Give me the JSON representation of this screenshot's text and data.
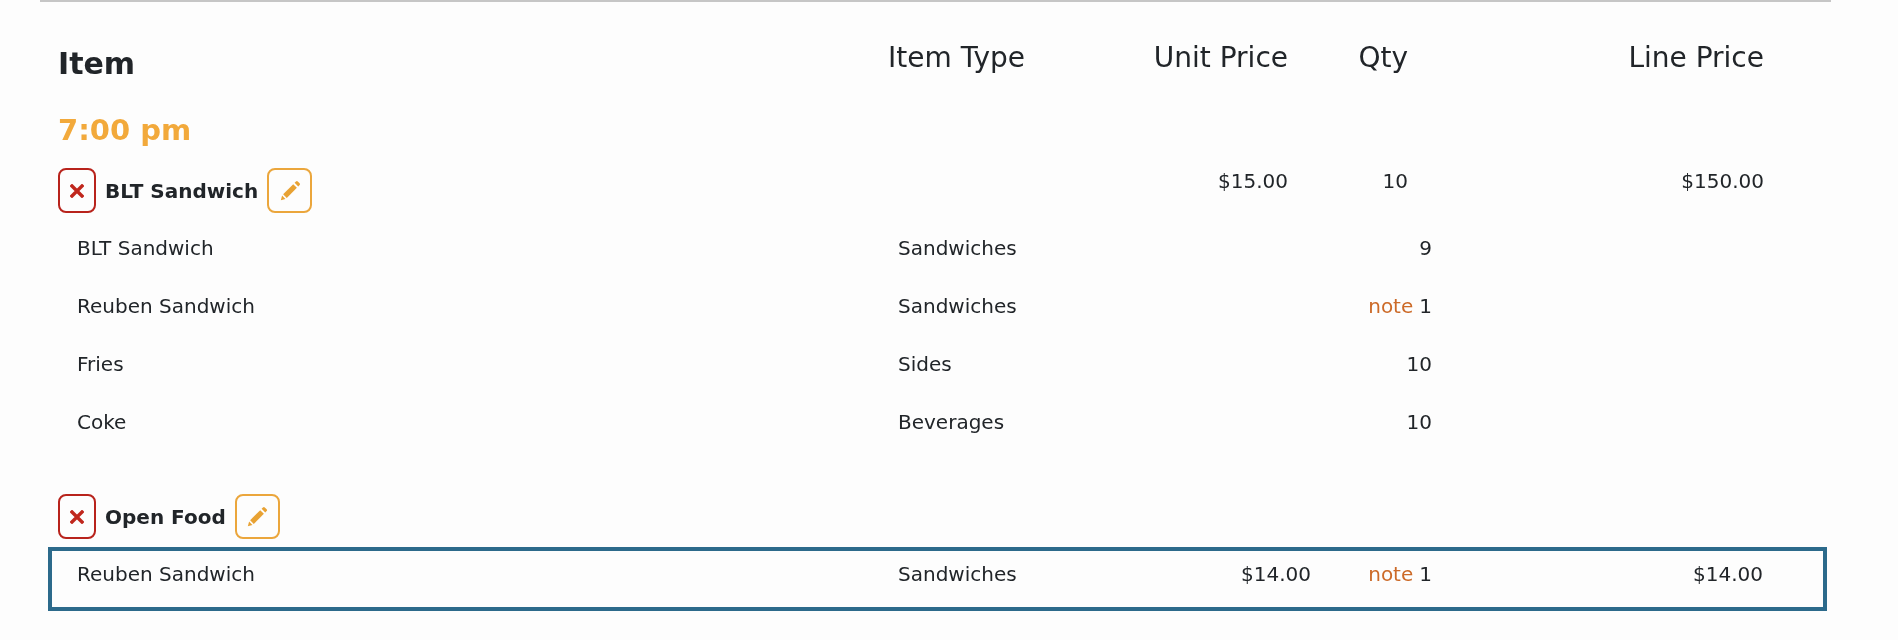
{
  "table": {
    "columns": [
      "Item",
      "Item Type",
      "Unit Price",
      "Qty",
      "Line Price"
    ]
  },
  "groups": [
    {
      "time": "7:00 pm",
      "orders": [
        {
          "name": "BLT Sandwich",
          "unit_price": "$15.00",
          "qty": "10",
          "line_price": "$150.00",
          "items": [
            {
              "name": "BLT Sandwich",
              "type": "Sandwiches",
              "qty": "9",
              "selected": false
            },
            {
              "name": "Reuben Sandwich",
              "type": "Sandwiches",
              "note": "note",
              "qty": "1",
              "selected": false
            },
            {
              "name": "Fries",
              "type": "Sides",
              "qty": "10",
              "selected": false
            },
            {
              "name": "Coke",
              "type": "Beverages",
              "qty": "10",
              "selected": false
            }
          ]
        },
        {
          "name": "Open Food",
          "items": [
            {
              "name": "Reuben Sandwich",
              "type": "Sandwiches",
              "unit_price": "$14.00",
              "note": "note",
              "qty": "1",
              "line_price": "$14.00",
              "selected": true
            }
          ]
        }
      ]
    }
  ]
}
